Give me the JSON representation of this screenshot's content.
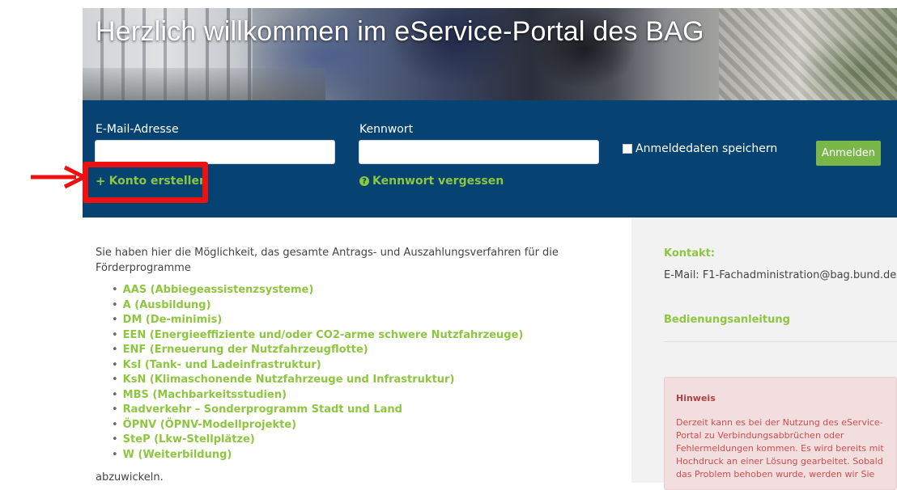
{
  "hero": {
    "title": "Herzlich willkommen im eService-Portal des BAG"
  },
  "login": {
    "email_label": "E-Mail-Adresse",
    "email_value": "",
    "password_label": "Kennwort",
    "password_value": "",
    "remember_label": "Anmeldedaten speichern",
    "login_button": "Anmelden",
    "create_account": "Konto erstellen",
    "forgot_password": "Kennwort vergessen"
  },
  "main": {
    "intro": "Sie haben hier die Möglichkeit, das gesamte Antrags- und Auszahlungsverfahren für die Förderprogramme",
    "programs": [
      "AAS (Abbiegeassistenzsysteme)",
      "A (Ausbildung)",
      "DM (De-minimis)",
      "EEN (Energieeffiziente und/oder CO2-arme schwere Nutzfahrzeuge)",
      "ENF (Erneuerung der Nutzfahrzeugflotte)",
      "KsI (Tank- und Ladeinfrastruktur)",
      "KsN (Klimaschonende Nutzfahrzeuge und Infrastruktur)",
      "MBS (Machbarkeitsstudien)",
      "Radverkehr – Sonderprogramm Stadt und Land",
      "ÖPNV (ÖPNV-Modellprojekte)",
      "SteP (Lkw-Stellplätze)",
      "W (Weiterbildung)"
    ],
    "outro": "abzuwickeln."
  },
  "sidebar": {
    "contact_heading": "Kontakt:",
    "contact_email": "E-Mail: F1-Fachadministration@bag.bund.de",
    "manual_link": "Bedienungsanleitung",
    "alert_title": "Hinweis",
    "alert_text": "Derzeit kann es bei der Nutzung des eService-Portal zu Verbindungsabbrüchen oder Fehlermeldungen kommen. Es wird bereits mit Hochdruck an einer Lösung gearbeitet. Sobald das Problem behoben wurde, werden wir Sie"
  },
  "colors": {
    "navy": "#064372",
    "green": "#8dc63f",
    "button_green": "#7ab648",
    "annotation_red": "#ee1111",
    "alert_bg": "#f2dede",
    "alert_text": "#a94442"
  },
  "icons": {
    "create_account": "plus-icon",
    "forgot_password": "question-circle-icon",
    "remember": "checkbox-icon"
  }
}
